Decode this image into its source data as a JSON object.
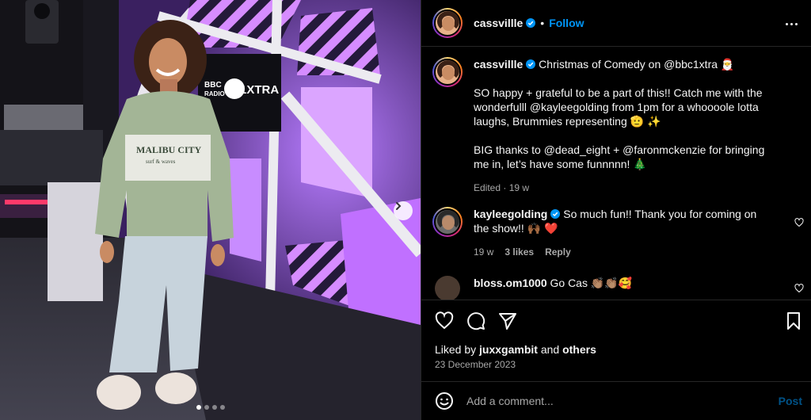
{
  "photo": {
    "sign_bbc": "BBC",
    "sign_radio": "RADIO",
    "sign_station": "1XTRA",
    "shirt_text_line1": "MALIBU CITY",
    "shirt_text_line2": "surf & waves"
  },
  "header": {
    "username": "cassvillle",
    "follow_label": "Follow"
  },
  "caption": {
    "username": "cassvillle",
    "text": "Christmas of Comedy on @bbc1xtra 🎅\n\nSO happy + grateful to be a part of this!! Catch me with the wonderfulll @kayleegolding from 1pm for a whoooole lotta laughs, Brummies representing 🫡 ✨\n\nBIG thanks to @dead_eight + @faronmckenzie for bringing me in, let’s have some funnnnn! 🎄",
    "meta": "Edited · 19 w"
  },
  "comments": [
    {
      "username": "kayleegolding",
      "text": "So much fun!! Thank you for coming on the show!! 🙌🏾 ❤️",
      "age": "19 w",
      "likes": "3 likes",
      "reply": "Reply"
    },
    {
      "username": "bloss.om1000",
      "text": "Go Cas 👏🏽👏🏽🥰"
    }
  ],
  "likes": {
    "prefix": "Liked by",
    "user": "juxxgambit",
    "middle": "and",
    "others": "others"
  },
  "date": "23 December 2023",
  "add_comment": {
    "placeholder": "Add a comment...",
    "post_label": "Post"
  },
  "carousel": {
    "count": 4,
    "active": 0
  },
  "colors": {
    "accent": "#0095f6",
    "neon": "#c66bff",
    "background": "#000000"
  },
  "icons": [
    "verified-badge-icon",
    "more-options-icon",
    "heart-icon",
    "comment-icon",
    "share-icon",
    "bookmark-icon",
    "emoji-icon",
    "chevron-right-icon"
  ]
}
